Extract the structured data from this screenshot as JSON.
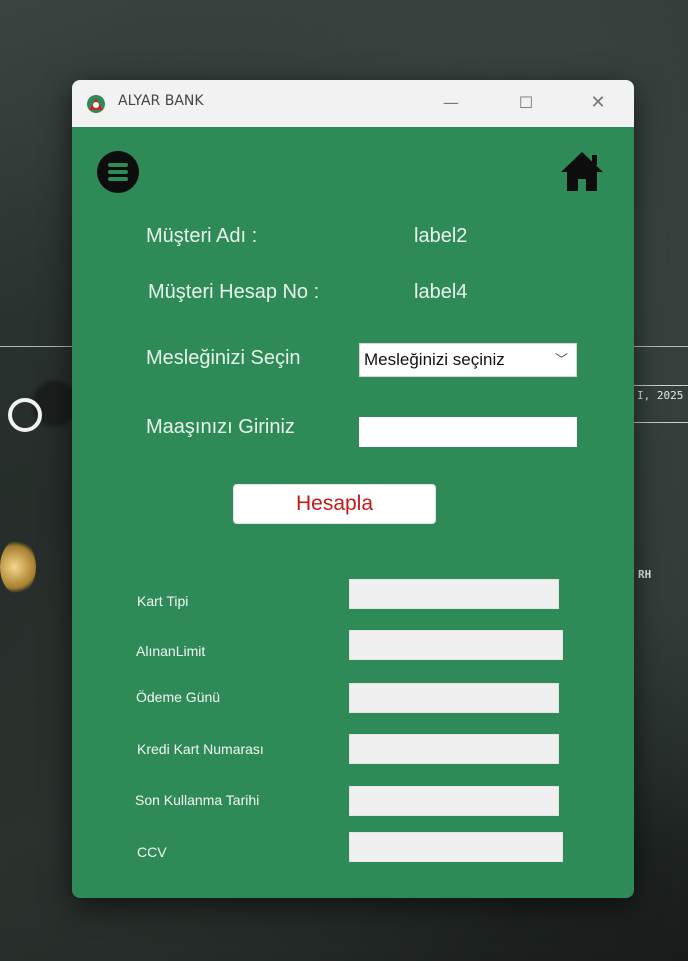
{
  "background": {
    "date_fragment": "I, 2025",
    "word_fragment": "RH"
  },
  "window": {
    "title": "ALYAR BANK",
    "controls": {
      "minimize": "—",
      "maximize": "☐",
      "close": "✕"
    }
  },
  "form": {
    "customer_name_label": "Müşteri Adı :",
    "customer_name_value": "label2",
    "account_no_label": "Müşteri Hesap No :",
    "account_no_value": "label4",
    "profession_label": "Mesleğinizi Seçin",
    "profession_selected": "Mesleğinizi seçiniz",
    "salary_label": "Maaşınızı Giriniz",
    "salary_value": "",
    "calculate_button": "Hesapla"
  },
  "card": {
    "fields": [
      {
        "label": "Kart Tipi",
        "value": ""
      },
      {
        "label": "AlınanLimit",
        "value": ""
      },
      {
        "label": "Ödeme Günü",
        "value": ""
      },
      {
        "label": "Kredi Kart Numarası",
        "value": ""
      },
      {
        "label": "Son Kullanma Tarihi",
        "value": ""
      },
      {
        "label": "CCV",
        "value": ""
      }
    ]
  },
  "colors": {
    "form_background": "#2e8b57",
    "button_text": "#c41a1a"
  }
}
